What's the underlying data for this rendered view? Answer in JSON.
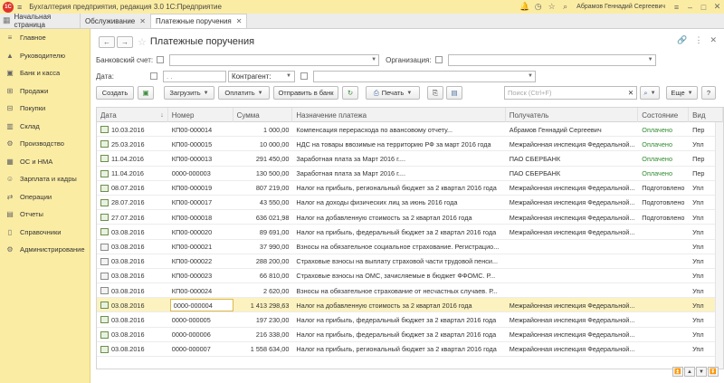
{
  "app": {
    "logo": "1С",
    "menu_icon": "menu-icon",
    "title": "Бухгалтерия предприятия, редакция 3.0 1С:Предприятие",
    "user": "Абрамов Геннадий Сергеевич"
  },
  "tabs": {
    "home": "Начальная страница",
    "items": [
      {
        "label": "Обслуживание",
        "active": false
      },
      {
        "label": "Платежные поручения",
        "active": true
      }
    ]
  },
  "sidebar": {
    "items": [
      {
        "label": "Главное",
        "icon": "menu-icon"
      },
      {
        "label": "Руководителю",
        "icon": "chart-icon"
      },
      {
        "label": "Банк и касса",
        "icon": "bank-icon"
      },
      {
        "label": "Продажи",
        "icon": "cart-icon"
      },
      {
        "label": "Покупки",
        "icon": "basket-icon"
      },
      {
        "label": "Склад",
        "icon": "warehouse-icon"
      },
      {
        "label": "Производство",
        "icon": "factory-icon"
      },
      {
        "label": "ОС и НМА",
        "icon": "assets-icon"
      },
      {
        "label": "Зарплата и кадры",
        "icon": "people-icon"
      },
      {
        "label": "Операции",
        "icon": "operations-icon"
      },
      {
        "label": "Отчеты",
        "icon": "reports-icon"
      },
      {
        "label": "Справочники",
        "icon": "book-icon"
      },
      {
        "label": "Администрирование",
        "icon": "gear-icon"
      }
    ]
  },
  "page": {
    "title": "Платежные поручения"
  },
  "filters": {
    "bank_account_label": "Банковский счет:",
    "organization_label": "Организация:",
    "date_label": "Дата:",
    "date_value": " .  .",
    "counterparty_label": "Контрагент:"
  },
  "toolbar": {
    "create": "Создать",
    "load": "Загрузить",
    "pay": "Оплатить",
    "send_bank": "Отправить в банк",
    "print": "Печать",
    "search_placeholder": "Поиск (Ctrl+F)",
    "more": "Еще",
    "help": "?"
  },
  "table": {
    "columns": [
      "Дата",
      "Номер",
      "Сумма",
      "Назначение платежа",
      "Получатель",
      "Состояние",
      "Вид"
    ],
    "rows": [
      {
        "date": "10.03.2016",
        "number": "КП00-000014",
        "amount": "1 000,00",
        "purpose": "Компенсация перерасхода по авансовому отчету...",
        "recipient": "Абрамов Геннадий Сергеевич",
        "status": "Оплачено",
        "kind": "Пер"
      },
      {
        "date": "25.03.2016",
        "number": "КП00-000015",
        "amount": "10 000,00",
        "purpose": "НДС на товары ввозимые на территорию РФ за март 2016 года",
        "recipient": "Межрайонная инспекция Федеральной...",
        "status": "Оплачено",
        "kind": "Упл"
      },
      {
        "date": "11.04.2016",
        "number": "КП00-000013",
        "amount": "291 450,00",
        "purpose": "Заработная плата за Март 2016 г....",
        "recipient": "ПАО СБЕРБАНК",
        "status": "Оплачено",
        "kind": "Пер"
      },
      {
        "date": "11.04.2016",
        "number": "0000-000003",
        "amount": "130 500,00",
        "purpose": "Заработная плата за Март 2016 г....",
        "recipient": "ПАО СБЕРБАНК",
        "status": "Оплачено",
        "kind": "Пер"
      },
      {
        "date": "08.07.2016",
        "number": "КП00-000019",
        "amount": "807 219,00",
        "purpose": "Налог на прибыль, региональный бюджет за 2 квартал 2016 года",
        "recipient": "Межрайонная инспекция Федеральной...",
        "status": "Подготовлено",
        "kind": "Упл"
      },
      {
        "date": "28.07.2016",
        "number": "КП00-000017",
        "amount": "43 550,00",
        "purpose": "Налог на доходы физических лиц за июнь 2016 года",
        "recipient": "Межрайонная инспекция Федеральной...",
        "status": "Подготовлено",
        "kind": "Упл"
      },
      {
        "date": "27.07.2016",
        "number": "КП00-000018",
        "amount": "636 021,98",
        "purpose": "Налог на добавленную стоимость за 2 квартал 2016 года",
        "recipient": "Межрайонная инспекция Федеральной...",
        "status": "Подготовлено",
        "kind": "Упл"
      },
      {
        "date": "03.08.2016",
        "number": "КП00-000020",
        "amount": "89 691,00",
        "purpose": "Налог на прибыль, федеральный бюджет за 2 квартал 2016 года",
        "recipient": "Межрайонная инспекция Федеральной...",
        "status": "",
        "kind": "Упл"
      },
      {
        "date": "03.08.2016",
        "number": "КП00-000021",
        "amount": "37 990,00",
        "purpose": "Взносы на обязательное социальное страхование. Регистрацио...",
        "recipient": "",
        "status": "",
        "kind": "Упл"
      },
      {
        "date": "03.08.2016",
        "number": "КП00-000022",
        "amount": "288 200,00",
        "purpose": "Страховые взносы на выплату страховой части трудовой пенси...",
        "recipient": "",
        "status": "",
        "kind": "Упл"
      },
      {
        "date": "03.08.2016",
        "number": "КП00-000023",
        "amount": "66 810,00",
        "purpose": "Страховые взносы на ОМС, зачисляемые в бюджет ФФОМС. Р...",
        "recipient": "",
        "status": "",
        "kind": "Упл"
      },
      {
        "date": "03.08.2016",
        "number": "КП00-000024",
        "amount": "2 620,00",
        "purpose": "Взносы на обязательное страхование от несчастных случаев. Р...",
        "recipient": "",
        "status": "",
        "kind": "Упл"
      },
      {
        "date": "03.08.2016",
        "number": "0000-000004",
        "amount": "1 413 298,63",
        "purpose": "Налог на добавленную стоимость за 2 квартал 2016 года",
        "recipient": "Межрайонная инспекция Федеральной...",
        "status": "",
        "kind": "Упл",
        "selected": true
      },
      {
        "date": "03.08.2016",
        "number": "0000-000005",
        "amount": "197 230,00",
        "purpose": "Налог на прибыль, федеральный бюджет за 2 квартал 2016 года",
        "recipient": "Межрайонная инспекция Федеральной...",
        "status": "",
        "kind": "Упл"
      },
      {
        "date": "03.08.2016",
        "number": "0000-000006",
        "amount": "216 338,00",
        "purpose": "Налог на прибыль, федеральный бюджет за 2 квартал 2016 года",
        "recipient": "Межрайонная инспекция Федеральной...",
        "status": "",
        "kind": "Упл"
      },
      {
        "date": "03.08.2016",
        "number": "0000-000007",
        "amount": "1 558 634,00",
        "purpose": "Налог на прибыль, региональный бюджет за 2 квартал 2016 года",
        "recipient": "Межрайонная инспекция Федеральной...",
        "status": "",
        "kind": "Упл"
      }
    ]
  },
  "colors": {
    "sidebar_bg": "#fbeca3",
    "status_paid": "#2f8a2f",
    "selected_row": "#fcf2c0"
  }
}
